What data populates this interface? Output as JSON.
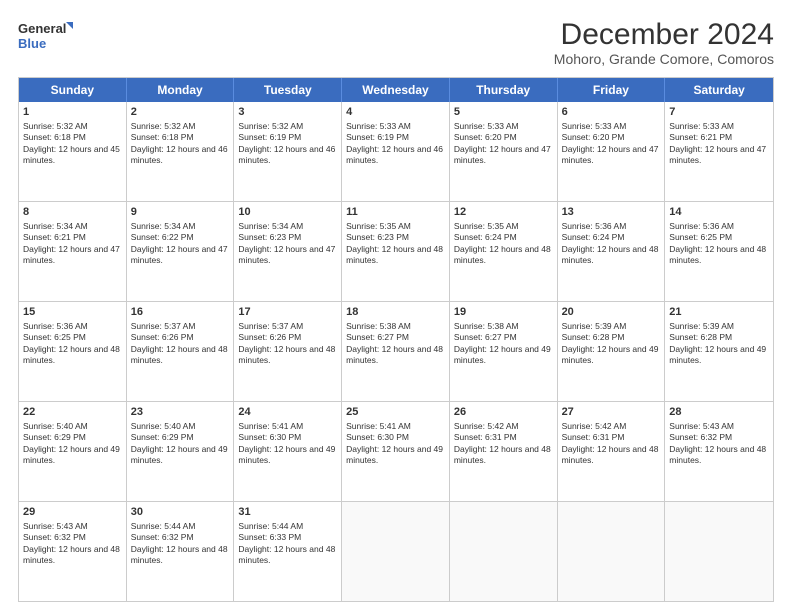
{
  "logo": {
    "line1": "General",
    "line2": "Blue"
  },
  "title": "December 2024",
  "subtitle": "Mohoro, Grande Comore, Comoros",
  "days": [
    "Sunday",
    "Monday",
    "Tuesday",
    "Wednesday",
    "Thursday",
    "Friday",
    "Saturday"
  ],
  "weeks": [
    [
      {
        "day": 1,
        "sunrise": "5:32 AM",
        "sunset": "6:18 PM",
        "daylight": "12 hours and 45 minutes."
      },
      {
        "day": 2,
        "sunrise": "5:32 AM",
        "sunset": "6:18 PM",
        "daylight": "12 hours and 46 minutes."
      },
      {
        "day": 3,
        "sunrise": "5:32 AM",
        "sunset": "6:19 PM",
        "daylight": "12 hours and 46 minutes."
      },
      {
        "day": 4,
        "sunrise": "5:33 AM",
        "sunset": "6:19 PM",
        "daylight": "12 hours and 46 minutes."
      },
      {
        "day": 5,
        "sunrise": "5:33 AM",
        "sunset": "6:20 PM",
        "daylight": "12 hours and 47 minutes."
      },
      {
        "day": 6,
        "sunrise": "5:33 AM",
        "sunset": "6:20 PM",
        "daylight": "12 hours and 47 minutes."
      },
      {
        "day": 7,
        "sunrise": "5:33 AM",
        "sunset": "6:21 PM",
        "daylight": "12 hours and 47 minutes."
      }
    ],
    [
      {
        "day": 8,
        "sunrise": "5:34 AM",
        "sunset": "6:21 PM",
        "daylight": "12 hours and 47 minutes."
      },
      {
        "day": 9,
        "sunrise": "5:34 AM",
        "sunset": "6:22 PM",
        "daylight": "12 hours and 47 minutes."
      },
      {
        "day": 10,
        "sunrise": "5:34 AM",
        "sunset": "6:23 PM",
        "daylight": "12 hours and 47 minutes."
      },
      {
        "day": 11,
        "sunrise": "5:35 AM",
        "sunset": "6:23 PM",
        "daylight": "12 hours and 48 minutes."
      },
      {
        "day": 12,
        "sunrise": "5:35 AM",
        "sunset": "6:24 PM",
        "daylight": "12 hours and 48 minutes."
      },
      {
        "day": 13,
        "sunrise": "5:36 AM",
        "sunset": "6:24 PM",
        "daylight": "12 hours and 48 minutes."
      },
      {
        "day": 14,
        "sunrise": "5:36 AM",
        "sunset": "6:25 PM",
        "daylight": "12 hours and 48 minutes."
      }
    ],
    [
      {
        "day": 15,
        "sunrise": "5:36 AM",
        "sunset": "6:25 PM",
        "daylight": "12 hours and 48 minutes."
      },
      {
        "day": 16,
        "sunrise": "5:37 AM",
        "sunset": "6:26 PM",
        "daylight": "12 hours and 48 minutes."
      },
      {
        "day": 17,
        "sunrise": "5:37 AM",
        "sunset": "6:26 PM",
        "daylight": "12 hours and 48 minutes."
      },
      {
        "day": 18,
        "sunrise": "5:38 AM",
        "sunset": "6:27 PM",
        "daylight": "12 hours and 48 minutes."
      },
      {
        "day": 19,
        "sunrise": "5:38 AM",
        "sunset": "6:27 PM",
        "daylight": "12 hours and 49 minutes."
      },
      {
        "day": 20,
        "sunrise": "5:39 AM",
        "sunset": "6:28 PM",
        "daylight": "12 hours and 49 minutes."
      },
      {
        "day": 21,
        "sunrise": "5:39 AM",
        "sunset": "6:28 PM",
        "daylight": "12 hours and 49 minutes."
      }
    ],
    [
      {
        "day": 22,
        "sunrise": "5:40 AM",
        "sunset": "6:29 PM",
        "daylight": "12 hours and 49 minutes."
      },
      {
        "day": 23,
        "sunrise": "5:40 AM",
        "sunset": "6:29 PM",
        "daylight": "12 hours and 49 minutes."
      },
      {
        "day": 24,
        "sunrise": "5:41 AM",
        "sunset": "6:30 PM",
        "daylight": "12 hours and 49 minutes."
      },
      {
        "day": 25,
        "sunrise": "5:41 AM",
        "sunset": "6:30 PM",
        "daylight": "12 hours and 49 minutes."
      },
      {
        "day": 26,
        "sunrise": "5:42 AM",
        "sunset": "6:31 PM",
        "daylight": "12 hours and 48 minutes."
      },
      {
        "day": 27,
        "sunrise": "5:42 AM",
        "sunset": "6:31 PM",
        "daylight": "12 hours and 48 minutes."
      },
      {
        "day": 28,
        "sunrise": "5:43 AM",
        "sunset": "6:32 PM",
        "daylight": "12 hours and 48 minutes."
      }
    ],
    [
      {
        "day": 29,
        "sunrise": "5:43 AM",
        "sunset": "6:32 PM",
        "daylight": "12 hours and 48 minutes."
      },
      {
        "day": 30,
        "sunrise": "5:44 AM",
        "sunset": "6:32 PM",
        "daylight": "12 hours and 48 minutes."
      },
      {
        "day": 31,
        "sunrise": "5:44 AM",
        "sunset": "6:33 PM",
        "daylight": "12 hours and 48 minutes."
      },
      null,
      null,
      null,
      null
    ]
  ]
}
